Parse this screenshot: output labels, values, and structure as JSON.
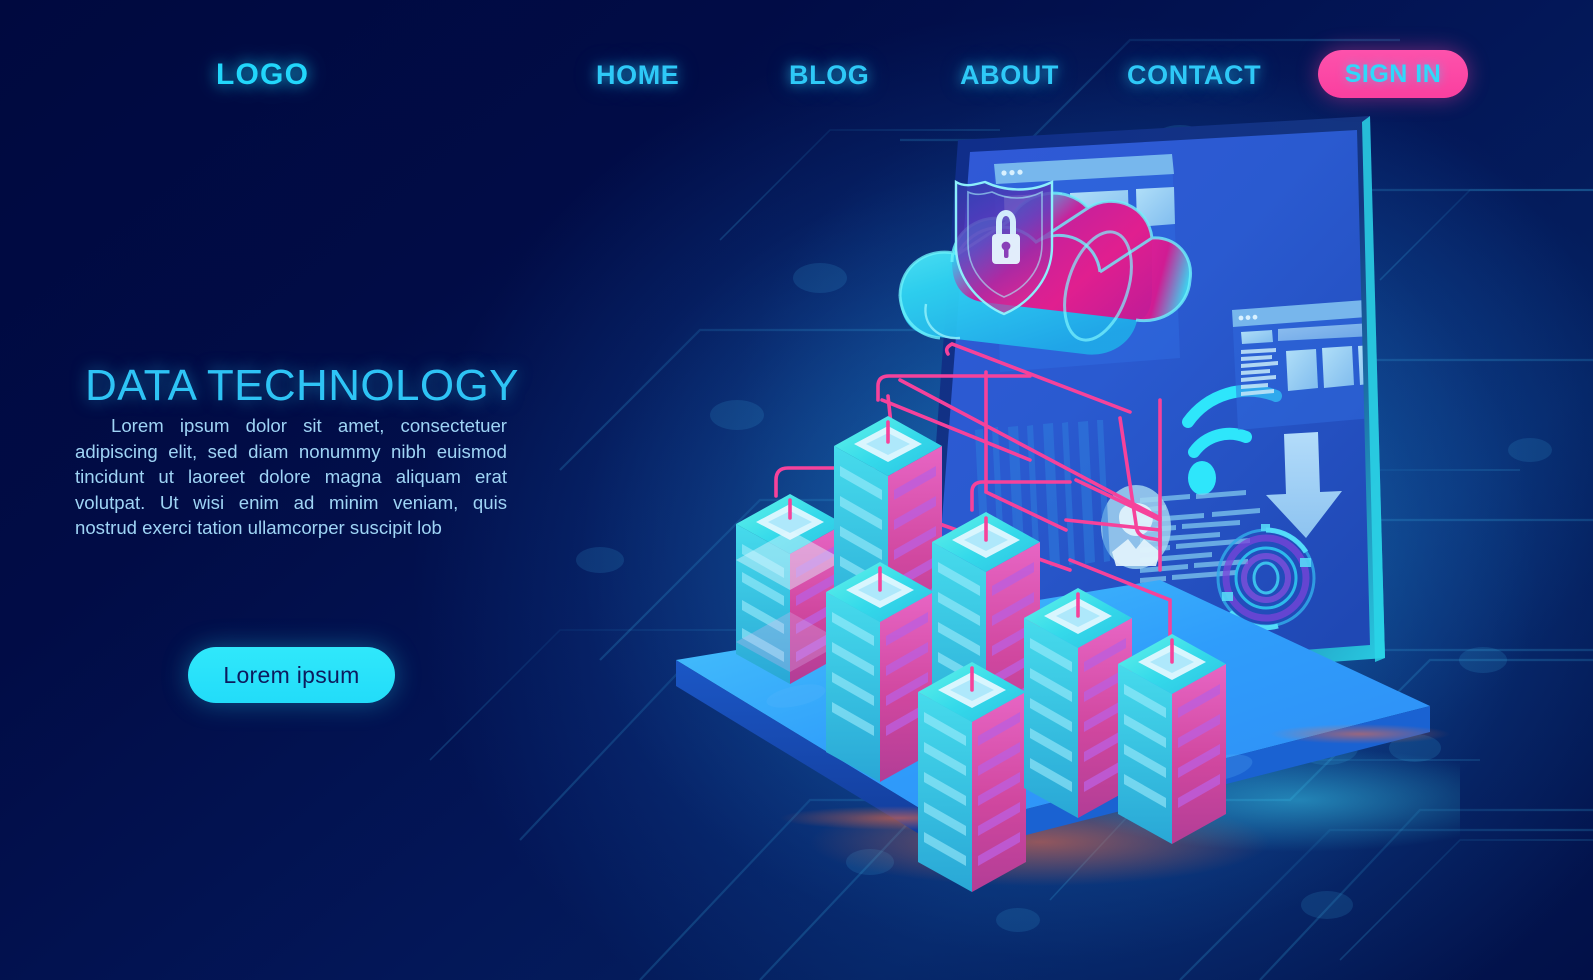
{
  "nav": {
    "logo": "LOGO",
    "items": [
      {
        "label": "HOME"
      },
      {
        "label": "BLOG"
      },
      {
        "label": "ABOUT"
      },
      {
        "label": "CONTACT"
      }
    ],
    "signin_label": "SIGN IN"
  },
  "hero": {
    "headline": "DATA TECHNOLOGY",
    "paragraph": "Lorem ipsum dolor sit amet, consectetuer adipiscing elit, sed diam nonummy nibh euismod tincidunt ut laoreet dolore magna aliquam erat volutpat. Ut wisi enim ad minim veniam, quis nostrud exerci tation ullamcorper suscipit lob",
    "cta_label": "Lorem ipsum"
  },
  "illustration": {
    "description": "Isometric laptop with cloud security and server racks",
    "cloud_icon": "shield-lock-icon",
    "screen_icons": [
      "wifi-icon",
      "user-avatar-icon",
      "down-arrow-icon",
      "radar-hud-icon"
    ],
    "server_rack_count": 7
  },
  "colors": {
    "background_dark": "#000a47",
    "background_mid": "#04205f",
    "accent_cyan": "#2ed8fb",
    "accent_pink": "#fa3f9f",
    "text_body": "#9fd4f5",
    "heading": "#2ec4f5",
    "cta_text": "#0d1b5e"
  }
}
